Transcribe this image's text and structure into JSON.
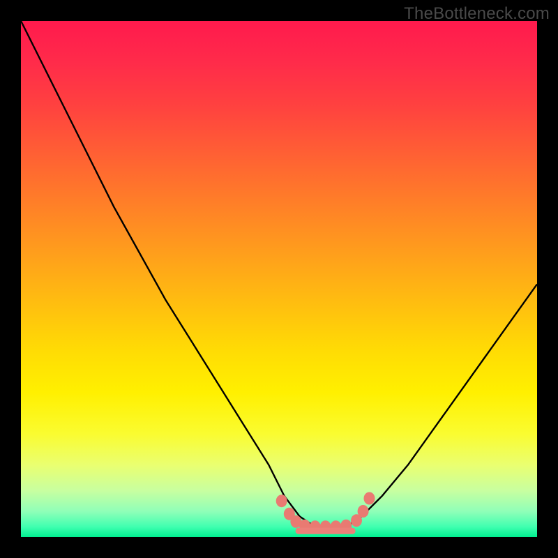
{
  "watermark": "TheBottleneck.com",
  "chart_data": {
    "type": "line",
    "title": "",
    "xlabel": "",
    "ylabel": "",
    "xlim": [
      0,
      100
    ],
    "ylim": [
      0,
      100
    ],
    "series": [
      {
        "name": "bottleneck-curve",
        "x": [
          0,
          3,
          8,
          13,
          18,
          23,
          28,
          33,
          38,
          43,
          48,
          51,
          54,
          57,
          60,
          63,
          66,
          70,
          75,
          80,
          85,
          90,
          95,
          100
        ],
        "values": [
          100,
          94,
          84,
          74,
          64,
          55,
          46,
          38,
          30,
          22,
          14,
          8,
          4,
          2,
          2,
          2,
          4,
          8,
          14,
          21,
          28,
          35,
          42,
          49
        ]
      }
    ],
    "markers": {
      "name": "highlight-dots",
      "color": "#e97a72",
      "points": [
        {
          "x": 50.5,
          "y": 7.0
        },
        {
          "x": 52.0,
          "y": 4.5
        },
        {
          "x": 53.3,
          "y": 3.0
        },
        {
          "x": 55.0,
          "y": 2.2
        },
        {
          "x": 57.0,
          "y": 2.0
        },
        {
          "x": 59.0,
          "y": 2.0
        },
        {
          "x": 61.0,
          "y": 2.0
        },
        {
          "x": 63.0,
          "y": 2.2
        },
        {
          "x": 65.0,
          "y": 3.2
        },
        {
          "x": 66.3,
          "y": 5.0
        },
        {
          "x": 67.5,
          "y": 7.5
        }
      ]
    },
    "bottom_strip": {
      "name": "highlight-strip",
      "color": "#ec8079",
      "x_start": 53.2,
      "x_end": 64.8,
      "y": 1.2,
      "thickness": 1.2
    }
  }
}
